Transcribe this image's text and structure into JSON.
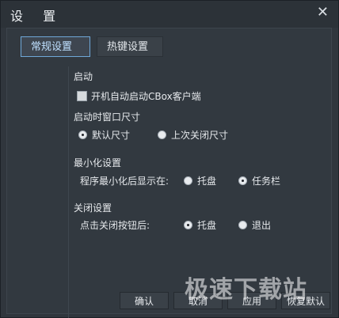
{
  "window": {
    "title": "设  置",
    "close_glyph": "✕"
  },
  "tabs": [
    {
      "label": "常规设置",
      "active": true
    },
    {
      "label": "热键设置",
      "active": false
    }
  ],
  "sections": {
    "startup": {
      "title": "启动",
      "autostart_label": "开机自动启动CBox客户端",
      "autostart_checked": false
    },
    "startup_size": {
      "title": "启动时窗口尺寸",
      "options": [
        {
          "label": "默认尺寸",
          "selected": true
        },
        {
          "label": "上次关闭尺寸",
          "selected": false
        }
      ]
    },
    "minimize": {
      "title": "最小化设置",
      "prompt": "程序最小化后显示在:",
      "options": [
        {
          "label": "托盘",
          "selected": false
        },
        {
          "label": "任务栏",
          "selected": true
        }
      ]
    },
    "close": {
      "title": "关闭设置",
      "prompt": "点击关闭按钮后:",
      "options": [
        {
          "label": "托盘",
          "selected": true
        },
        {
          "label": "退出",
          "selected": false
        }
      ]
    }
  },
  "footer": {
    "confirm": "确认",
    "cancel": "取消",
    "apply": "应用",
    "restore": "恢复默认"
  },
  "watermark": "极速下载站",
  "colors": {
    "window_bg": "#30363d",
    "accent": "#6fa8d8"
  }
}
